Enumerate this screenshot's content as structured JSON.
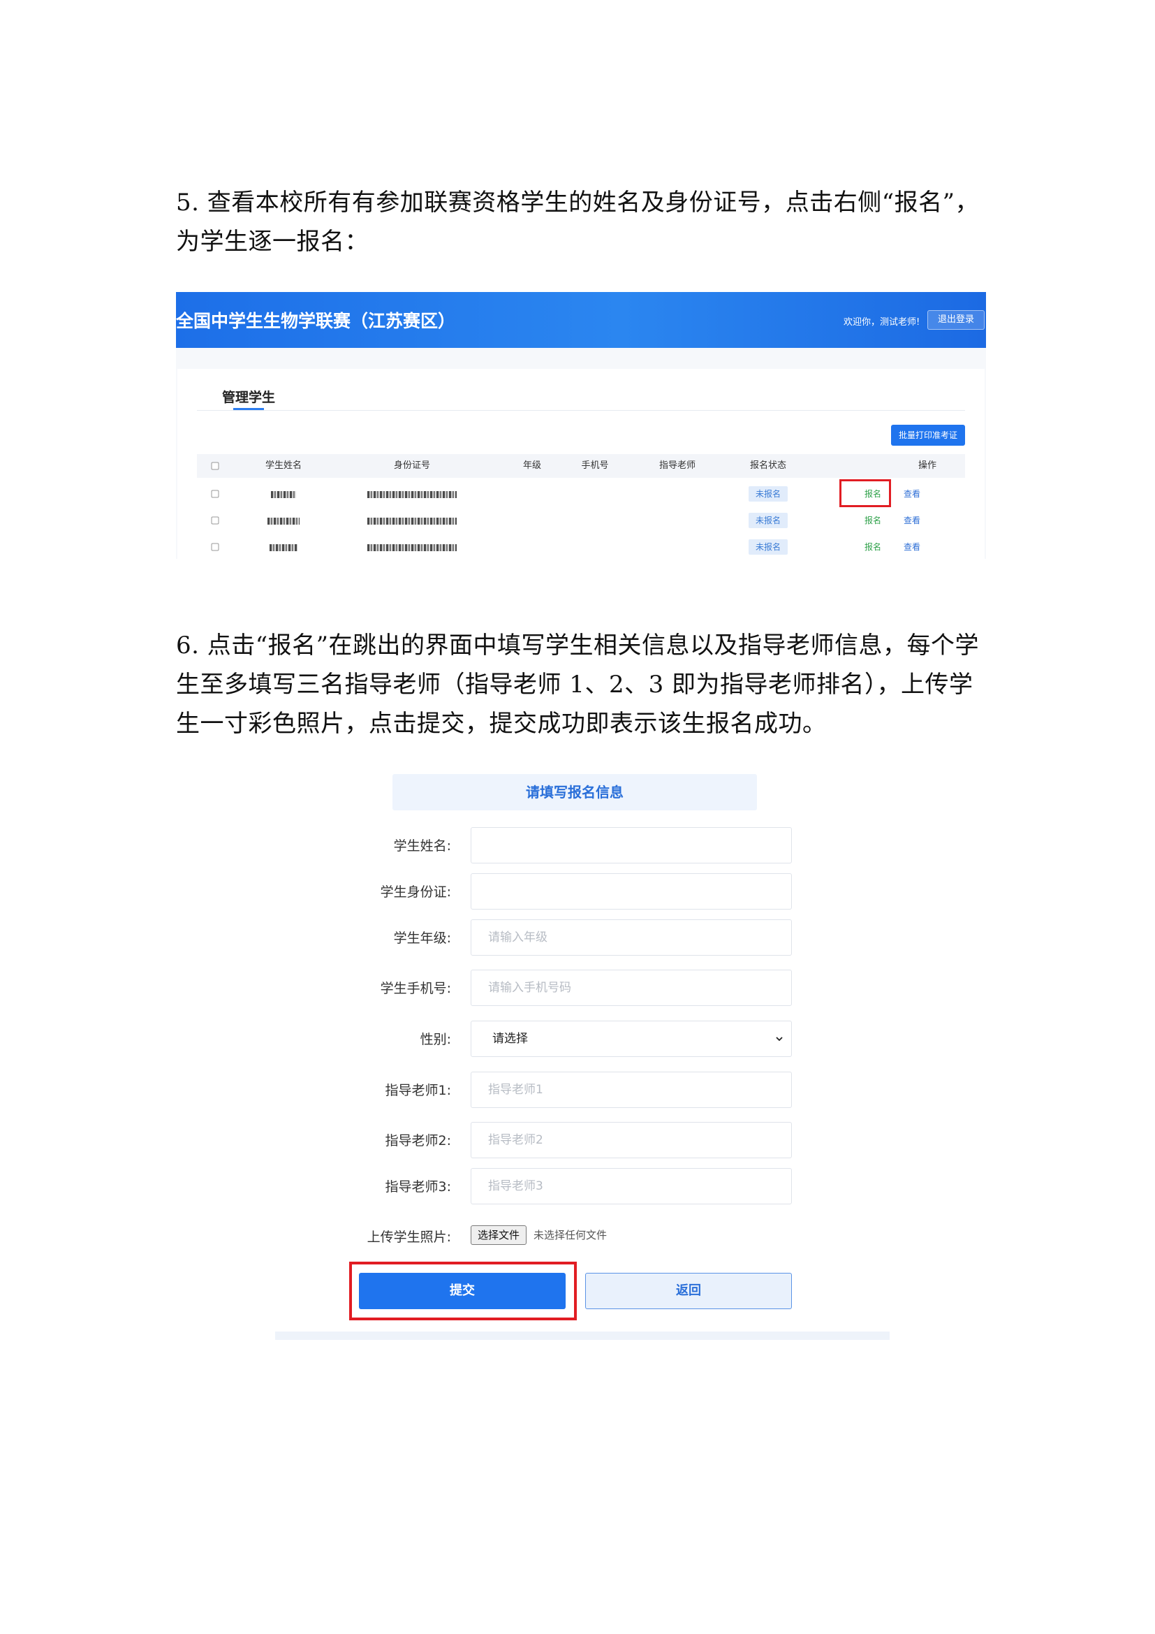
{
  "section5": {
    "text": "5. 查看本校所有有参加联赛资格学生的姓名及身份证号，点击右侧“报名”，为学生逐一报名："
  },
  "screenshot1": {
    "header_title": "全国中学生生物学联赛（江苏赛区）",
    "welcome": "欢迎你，测试老师!",
    "logout_label": "退出登录",
    "tab_label": "管理学生",
    "batch_print_label": "批量打印准考证",
    "columns": [
      "学生姓名",
      "身份证号",
      "年级",
      "手机号",
      "指导老师",
      "报名状态",
      "操作"
    ],
    "rows": [
      {
        "status": "未报名",
        "action_register": "报名",
        "action_view": "查看"
      },
      {
        "status": "未报名",
        "action_register": "报名",
        "action_view": "查看"
      },
      {
        "status": "未报名",
        "action_register": "报名",
        "action_view": "查看"
      }
    ],
    "colors": {
      "header": "#1f74ee",
      "register_link": "#2fa14a",
      "view_link": "#2f6fd6",
      "highlight": "#e11d23"
    }
  },
  "section6": {
    "text": "6. 点击“报名”在跳出的界面中填写学生相关信息以及指导老师信息，每个学生至多填写三名指导老师（指导老师 1、2、3 即为指导老师排名），上传学生一寸彩色照片，点击提交，提交成功即表示该生报名成功。"
  },
  "form": {
    "title": "请填写报名信息",
    "fields": {
      "name": {
        "label": "学生姓名:",
        "value": "",
        "placeholder": ""
      },
      "id_card": {
        "label": "学生身份证:",
        "value": "",
        "placeholder": ""
      },
      "grade": {
        "label": "学生年级:",
        "value": "",
        "placeholder": "请输入年级"
      },
      "phone": {
        "label": "学生手机号:",
        "value": "",
        "placeholder": "请输入手机号码"
      },
      "gender": {
        "label": "性别:",
        "selected": "请选择"
      },
      "teacher1": {
        "label": "指导老师1:",
        "value": "",
        "placeholder": "指导老师1"
      },
      "teacher2": {
        "label": "指导老师2:",
        "value": "",
        "placeholder": "指导老师2"
      },
      "teacher3": {
        "label": "指导老师3:",
        "value": "",
        "placeholder": "指导老师3"
      },
      "photo": {
        "label": "上传学生照片:",
        "button": "选择文件",
        "status": "未选择任何文件"
      }
    },
    "submit_label": "提交",
    "back_label": "返回",
    "colors": {
      "primary": "#1f74ee",
      "highlight": "#e11d23"
    }
  }
}
